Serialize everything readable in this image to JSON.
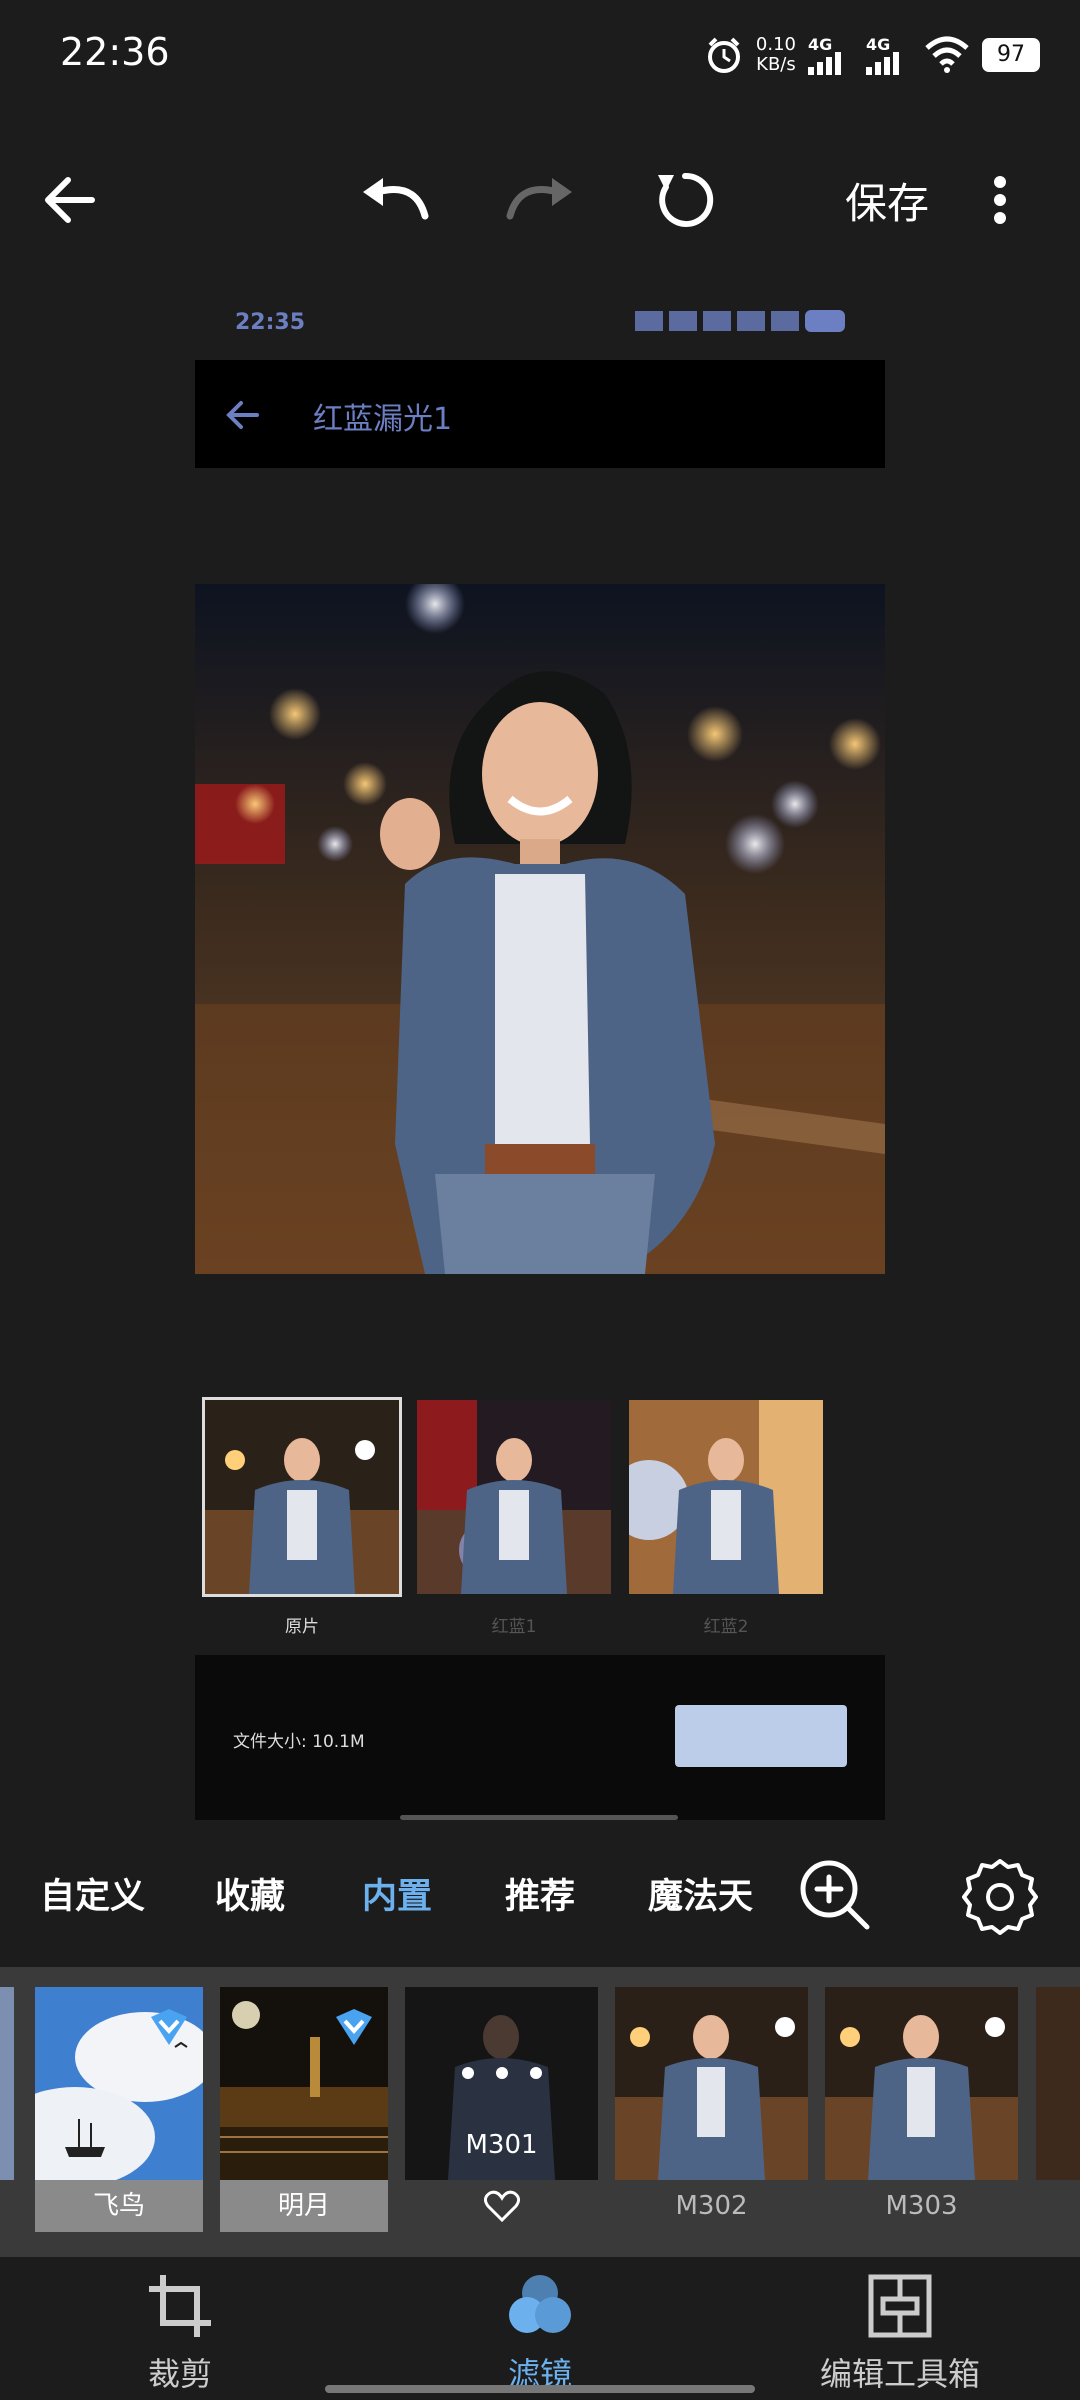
{
  "status_bar": {
    "time": "22:36",
    "net_speed_value": "0.10",
    "net_speed_unit": "KB/s",
    "signal1": "4G",
    "signal2": "4G",
    "battery": "97"
  },
  "toolbar": {
    "save_label": "保存"
  },
  "preview": {
    "status_time": "22:35",
    "title": "红蓝漏光1",
    "thumbnails": [
      {
        "label": "原片"
      },
      {
        "label": "红蓝1"
      },
      {
        "label": "红蓝2"
      }
    ],
    "file_size": "文件大小: 10.1M"
  },
  "tabs": [
    {
      "label": "自定义"
    },
    {
      "label": "收藏"
    },
    {
      "label": "内置"
    },
    {
      "label": "推荐"
    },
    {
      "label": "魔法天"
    }
  ],
  "active_tab": "内置",
  "filters": [
    {
      "label": "飞鸟",
      "badge": "heart-shield-icon"
    },
    {
      "label": "明月",
      "badge": "heart-shield-icon"
    },
    {
      "label": "M301",
      "selected": true
    },
    {
      "label": "M302"
    },
    {
      "label": "M303"
    }
  ],
  "bottom_nav": [
    {
      "label": "裁剪",
      "icon": "crop-icon"
    },
    {
      "label": "滤镜",
      "icon": "filter-icon"
    },
    {
      "label": "编辑工具箱",
      "icon": "toolbox-icon"
    }
  ],
  "active_nav": "滤镜",
  "colors": {
    "accent": "#6cb1ee",
    "background": "#1c1c1c",
    "strip_background": "#3a3a3a",
    "preview_accent": "#6b7fc2"
  }
}
